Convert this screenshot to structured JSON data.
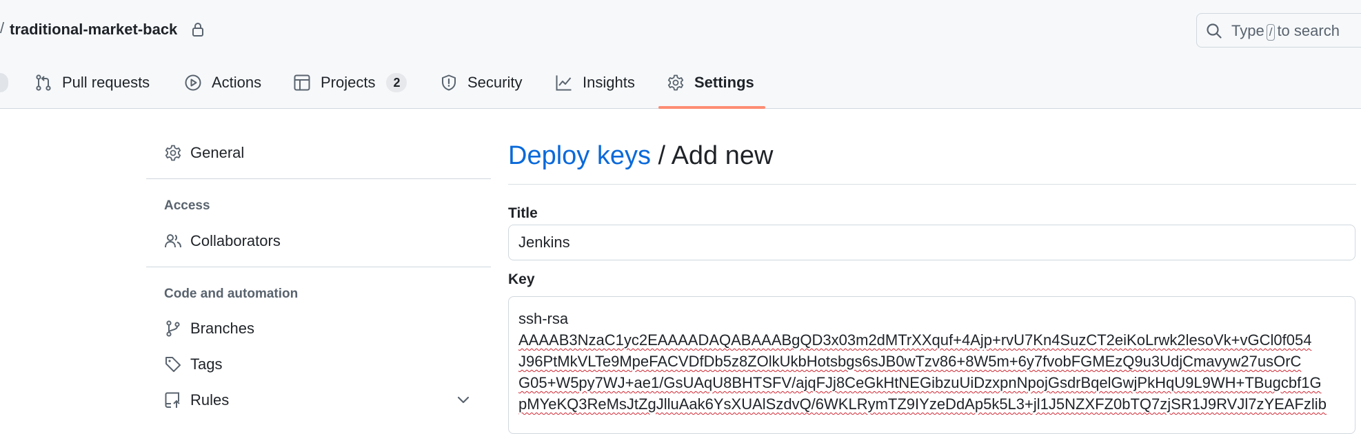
{
  "repo": {
    "name": "traditional-market-back",
    "lock_icon": "lock-icon"
  },
  "search": {
    "prefix": "Type",
    "key": "/",
    "suffix": "to search",
    "icon": "search-icon"
  },
  "tabs": [
    {
      "label": "Pull requests",
      "icon": "git-pull-request-icon"
    },
    {
      "label": "Actions",
      "icon": "play-icon"
    },
    {
      "label": "Projects",
      "icon": "table-icon",
      "count": "2"
    },
    {
      "label": "Security",
      "icon": "shield-icon"
    },
    {
      "label": "Insights",
      "icon": "graph-icon"
    },
    {
      "label": "Settings",
      "icon": "gear-icon",
      "selected": true
    }
  ],
  "colors": {
    "accent_link": "#0969da",
    "selected_tab_underline": "#fd8c73",
    "header_bg": "#f6f8fa"
  },
  "sidebar": {
    "general": {
      "label": "General",
      "icon": "gear-icon"
    },
    "access_heading": "Access",
    "collaborators": {
      "label": "Collaborators",
      "icon": "people-icon"
    },
    "code_heading": "Code and automation",
    "branches": {
      "label": "Branches",
      "icon": "git-branch-icon"
    },
    "tags": {
      "label": "Tags",
      "icon": "tag-icon"
    },
    "rules": {
      "label": "Rules",
      "icon": "repo-push-icon",
      "expand_icon": "chevron-down-icon"
    }
  },
  "main": {
    "breadcrumb_link": "Deploy keys",
    "breadcrumb_separator": "/",
    "breadcrumb_current": "Add new",
    "title_label": "Title",
    "title_value": "Jenkins",
    "key_label": "Key",
    "key_lines": [
      "ssh-rsa",
      "AAAAB3NzaC1yc2EAAAADAQABAAABgQD3x03m2dMTrXXquf+4Ajp+rvU7Kn4SuzCT2eiKoLrwk2lesoVk+vGCl0f054",
      "J96PtMkVLTe9MpeFACVDfDb5z8ZOlkUkbHotsbgs6sJB0wTzv86+8W5m+6y7fvobFGMEzQ9u3UdjCmavyw27usOrC",
      "G05+W5py7WJ+ae1/GsUAqU8BHTSFV/ajqFJj8CeGkHtNEGibzuUiDzxpnNpojGsdrBqelGwjPkHqU9L9WH+TBugcbf1G",
      "pMYeKQ3ReMsJtZgJlluAak6YsXUAlSzdvQ/6WKLRymTZ9IYzeDdAp5k5L3+jl1J5NZXFZ0bTQ7zjSR1J9RVJl7zYEAFzlib"
    ]
  }
}
